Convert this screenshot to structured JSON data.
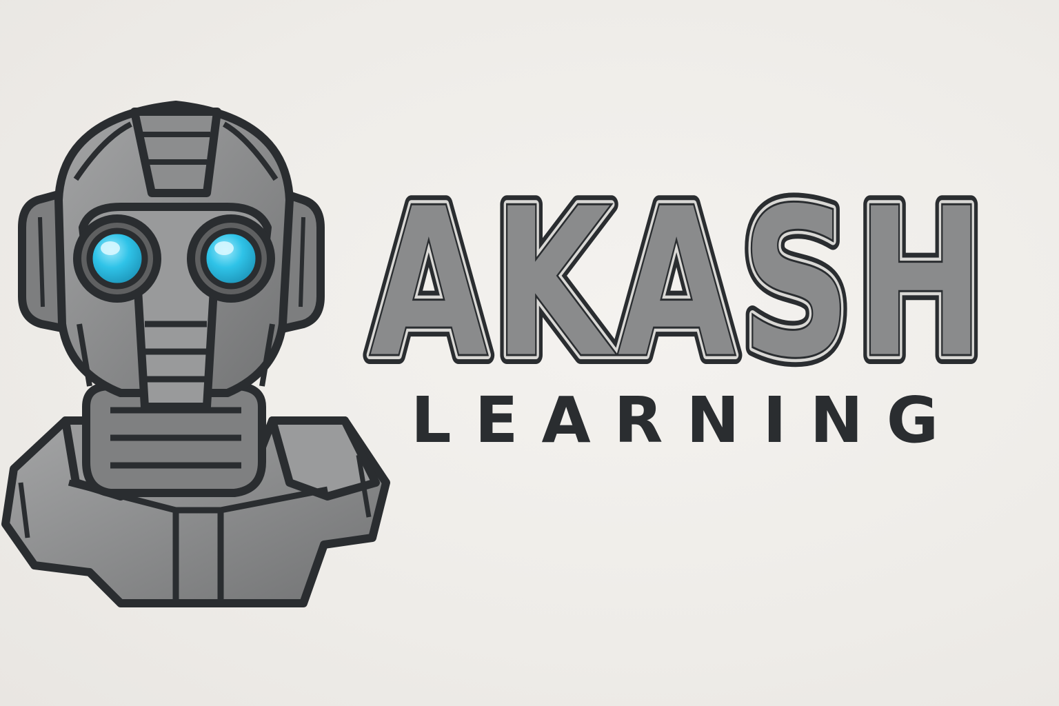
{
  "brand": {
    "name": "AKASH",
    "tagline": "LEARNING"
  },
  "mascot": {
    "icon": "robot-mascot-icon",
    "eye_color": "#2fc3e8"
  },
  "colors": {
    "background": "#efedea",
    "outline": "#2a2d30",
    "metal": "#8a8b8c",
    "metal_dark": "#6c6d6e",
    "metal_light": "#b8b8b6",
    "text": "#2a2d30"
  }
}
